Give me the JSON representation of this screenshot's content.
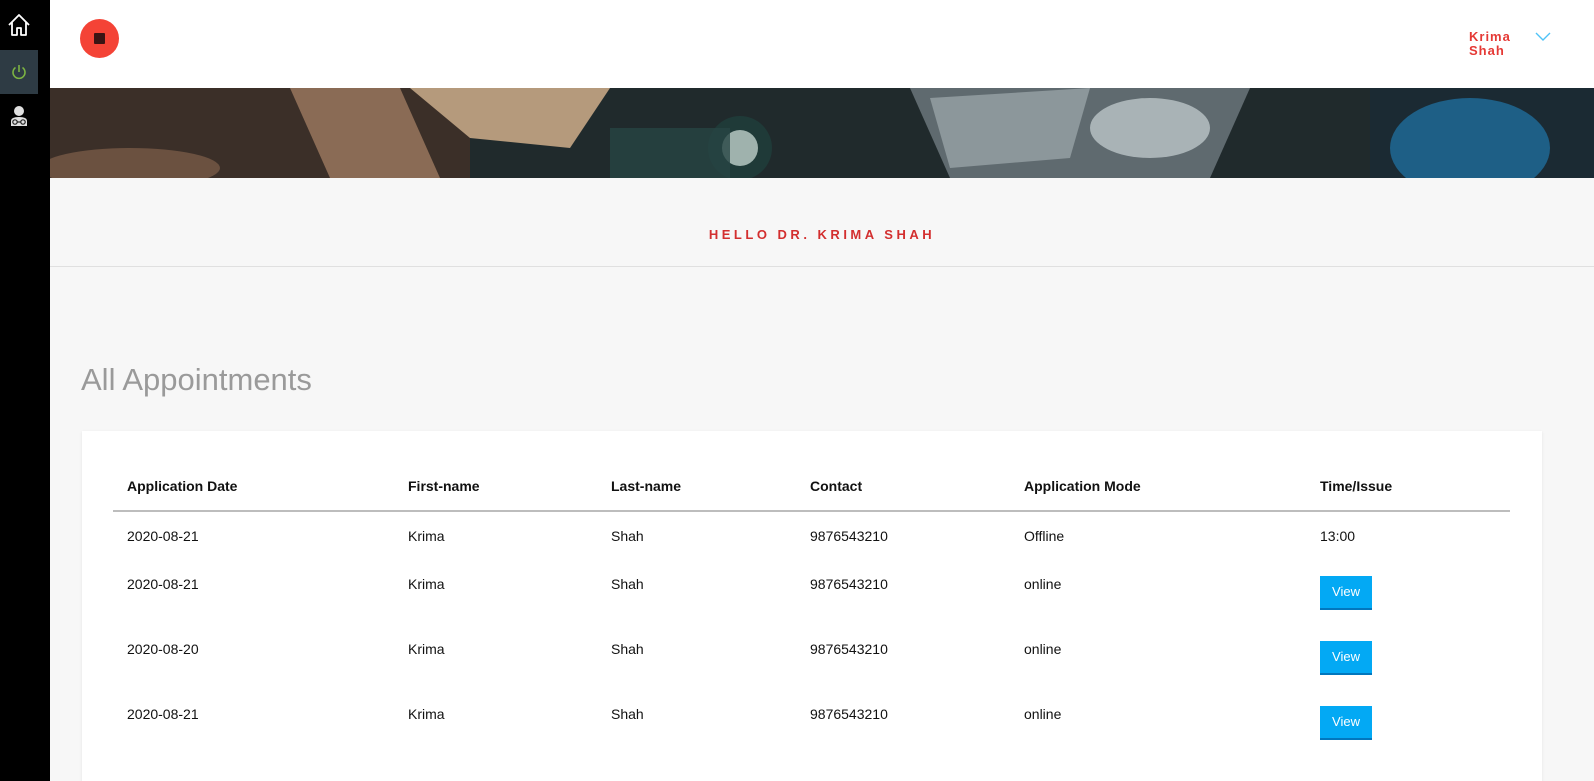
{
  "sidebar": {
    "items": [
      {
        "name": "home",
        "icon": "home-icon"
      },
      {
        "name": "logout",
        "icon": "power-icon",
        "active": true
      },
      {
        "name": "doctor",
        "icon": "doctor-icon"
      }
    ]
  },
  "header": {
    "user_name": "Krima Shah",
    "logo_icon": "logo-icon"
  },
  "greeting": "HELLO DR. KRIMA SHAH",
  "page_title": "All Appointments",
  "table": {
    "headers": [
      "Application Date",
      "First-name",
      "Last-name",
      "Contact",
      "Application Mode",
      "Time/Issue"
    ],
    "rows": [
      {
        "date": "2020-08-21",
        "first": "Krima",
        "last": "Shah",
        "contact": "9876543210",
        "mode": "Offline",
        "time": "13:00"
      },
      {
        "date": "2020-08-21",
        "first": "Krima",
        "last": "Shah",
        "contact": "9876543210",
        "mode": "online",
        "action": "View"
      },
      {
        "date": "2020-08-20",
        "first": "Krima",
        "last": "Shah",
        "contact": "9876543210",
        "mode": "online",
        "action": "View"
      },
      {
        "date": "2020-08-21",
        "first": "Krima",
        "last": "Shah",
        "contact": "9876543210",
        "mode": "online",
        "action": "View"
      }
    ]
  },
  "colors": {
    "accent_red": "#e53935",
    "button_blue": "#03a9f4",
    "sidebar_bg": "#000000",
    "power_green": "#7cb342"
  }
}
